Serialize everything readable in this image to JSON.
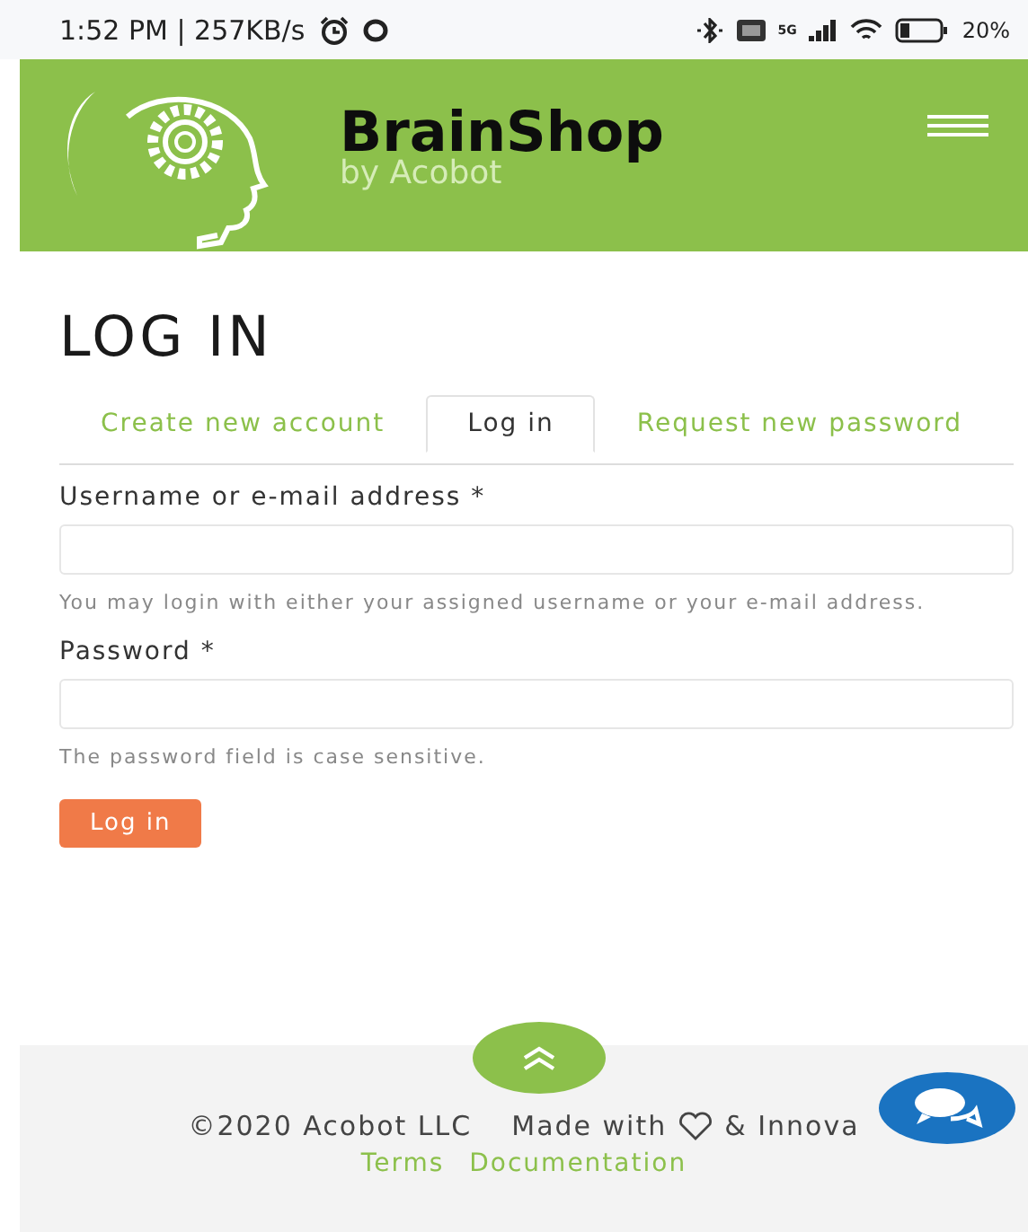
{
  "status_bar": {
    "time": "1:52 PM | 257KB/s",
    "network_label": "5G",
    "battery": "20%"
  },
  "header": {
    "brand": "BrainShop",
    "tagline": "by Acobot"
  },
  "page_title": "LOG IN",
  "tabs": [
    {
      "label": "Create new account",
      "selected": false
    },
    {
      "label": "Log in",
      "selected": true
    },
    {
      "label": "Request new password",
      "selected": false
    }
  ],
  "fields": [
    {
      "label": "Username or e-mail address *",
      "description": "You may login with either your assigned username or your e-mail address."
    },
    {
      "label": "Password *",
      "description": "The password field is case sensitive."
    }
  ],
  "submit": "Log in",
  "footer": {
    "copyright": "©2020 Acobot LLC",
    "made_with": "Made with",
    "made_tail": "& Innova",
    "links": [
      "Terms",
      "Documentation"
    ]
  }
}
